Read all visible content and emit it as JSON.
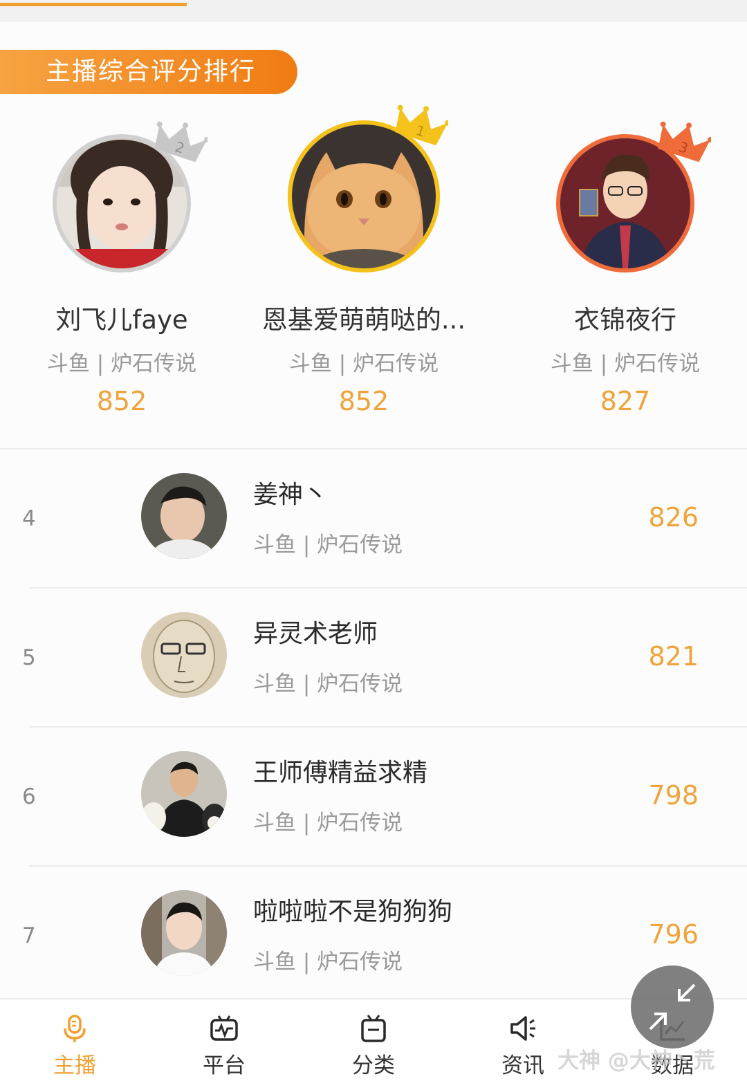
{
  "section_title": "主播综合评分排行",
  "podium": [
    {
      "rank": 2,
      "name": "刘飞儿faye",
      "platform": "斗鱼 | 炉石传说",
      "score": "852",
      "crown_color": "#c7c7c7"
    },
    {
      "rank": 1,
      "name": "恩基爱萌萌哒的...",
      "platform": "斗鱼 | 炉石传说",
      "score": "852",
      "crown_color": "#f4c21a"
    },
    {
      "rank": 3,
      "name": "衣锦夜行",
      "platform": "斗鱼 | 炉石传说",
      "score": "827",
      "crown_color": "#ef6b3a"
    }
  ],
  "list": [
    {
      "rank": "4",
      "name": "姜神丶",
      "platform": "斗鱼 | 炉石传说",
      "score": "826"
    },
    {
      "rank": "5",
      "name": "异灵术老师",
      "platform": "斗鱼 | 炉石传说",
      "score": "821"
    },
    {
      "rank": "6",
      "name": "王师傅精益求精",
      "platform": "斗鱼 | 炉石传说",
      "score": "798"
    },
    {
      "rank": "7",
      "name": "啦啦啦不是狗狗狗",
      "platform": "斗鱼 | 炉石传说",
      "score": "796"
    }
  ],
  "bottom_nav": [
    {
      "label": "主播",
      "icon": "microphone-icon",
      "active": true
    },
    {
      "label": "平台",
      "icon": "tv-pulse-icon",
      "active": false
    },
    {
      "label": "分类",
      "icon": "category-tv-icon",
      "active": false
    },
    {
      "label": "资讯",
      "icon": "speaker-icon",
      "active": false
    },
    {
      "label": "数据",
      "icon": "chart-icon",
      "active": false
    }
  ],
  "fab_icon": "collapse-arrows-icon",
  "watermark": "大神 @大神丶荒",
  "colors": {
    "accent": "#f0a030",
    "score": "#efa33a",
    "banner_start": "#f6a342",
    "banner_end": "#f07c12"
  }
}
